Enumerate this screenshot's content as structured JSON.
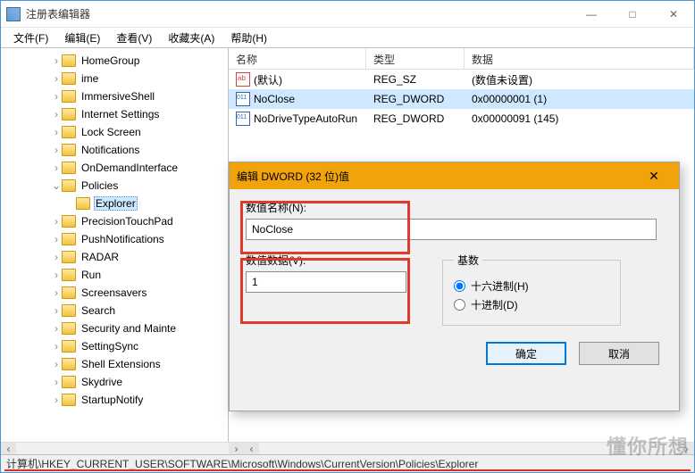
{
  "window": {
    "title": "注册表编辑器",
    "controls": {
      "min": "—",
      "max": "□",
      "close": "✕"
    }
  },
  "menu": {
    "file": "文件(F)",
    "edit": "编辑(E)",
    "view": "查看(V)",
    "favorites": "收藏夹(A)",
    "help": "帮助(H)"
  },
  "tree": {
    "items": [
      {
        "indent": 3,
        "exp": "›",
        "label": "HomeGroup"
      },
      {
        "indent": 3,
        "exp": "›",
        "label": "ime"
      },
      {
        "indent": 3,
        "exp": "›",
        "label": "ImmersiveShell"
      },
      {
        "indent": 3,
        "exp": "›",
        "label": "Internet Settings"
      },
      {
        "indent": 3,
        "exp": "›",
        "label": "Lock Screen"
      },
      {
        "indent": 3,
        "exp": "›",
        "label": "Notifications"
      },
      {
        "indent": 3,
        "exp": "›",
        "label": "OnDemandInterface"
      },
      {
        "indent": 3,
        "exp": "⌄",
        "label": "Policies"
      },
      {
        "indent": 4,
        "exp": "",
        "label": "Explorer",
        "selected": true
      },
      {
        "indent": 3,
        "exp": "›",
        "label": "PrecisionTouchPad"
      },
      {
        "indent": 3,
        "exp": "›",
        "label": "PushNotifications"
      },
      {
        "indent": 3,
        "exp": "›",
        "label": "RADAR"
      },
      {
        "indent": 3,
        "exp": "›",
        "label": "Run"
      },
      {
        "indent": 3,
        "exp": "›",
        "label": "Screensavers"
      },
      {
        "indent": 3,
        "exp": "›",
        "label": "Search"
      },
      {
        "indent": 3,
        "exp": "›",
        "label": "Security and Mainte"
      },
      {
        "indent": 3,
        "exp": "›",
        "label": "SettingSync"
      },
      {
        "indent": 3,
        "exp": "›",
        "label": "Shell Extensions"
      },
      {
        "indent": 3,
        "exp": "›",
        "label": "Skydrive"
      },
      {
        "indent": 3,
        "exp": "›",
        "label": "StartupNotify"
      }
    ]
  },
  "list": {
    "headers": {
      "name": "名称",
      "type": "类型",
      "data": "数据"
    },
    "rows": [
      {
        "icon": "str",
        "name": "(默认)",
        "type": "REG_SZ",
        "data": "(数值未设置)"
      },
      {
        "icon": "bin",
        "name": "NoClose",
        "type": "REG_DWORD",
        "data": "0x00000001 (1)",
        "selected": true
      },
      {
        "icon": "bin",
        "name": "NoDriveTypeAutoRun",
        "type": "REG_DWORD",
        "data": "0x00000091 (145)"
      }
    ]
  },
  "dialog": {
    "title": "编辑 DWORD (32 位)值",
    "name_label": "数值名称(N):",
    "name_value": "NoClose",
    "data_label": "数值数据(V):",
    "data_value": "1",
    "base_legend": "基数",
    "radix_hex": "十六进制(H)",
    "radix_dec": "十进制(D)",
    "ok": "确定",
    "cancel": "取消",
    "close": "✕"
  },
  "status": {
    "path": "计算机\\HKEY_CURRENT_USER\\SOFTWARE\\Microsoft\\Windows\\CurrentVersion\\Policies\\Explorer"
  }
}
